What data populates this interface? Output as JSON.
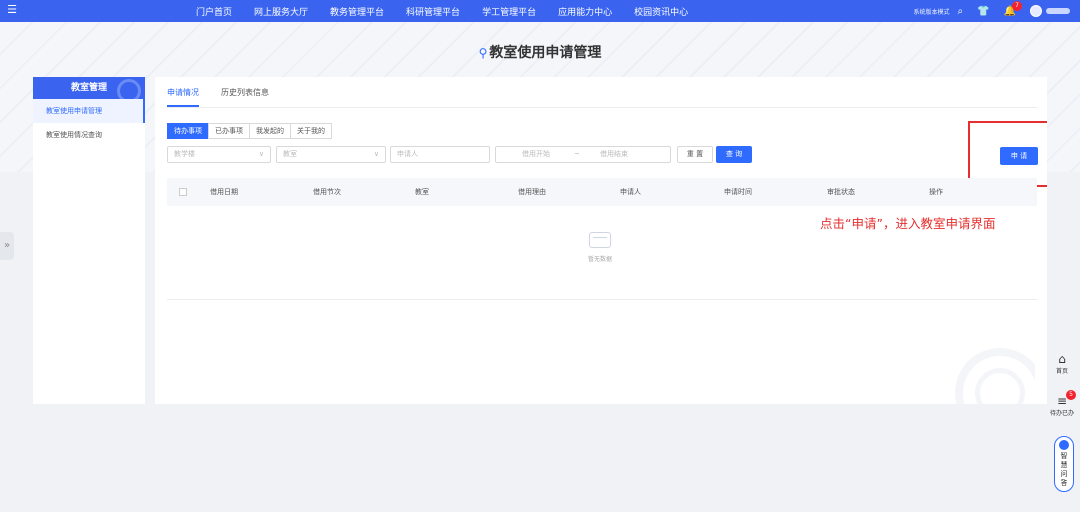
{
  "topbar": {
    "nav": [
      "门户首页",
      "网上服务大厅",
      "教务管理平台",
      "科研管理平台",
      "学工管理平台",
      "应用能力中心",
      "校园资讯中心"
    ],
    "switch_label": "系统版本模式",
    "bell_count": "7"
  },
  "page": {
    "title": "教室使用申请管理"
  },
  "sidebar": {
    "header": "教室管理",
    "items": [
      {
        "label": "教室使用申请管理"
      },
      {
        "label": "教室使用情况查询"
      }
    ]
  },
  "tabs": [
    "申请情况",
    "历史列表信息"
  ],
  "segments": [
    "待办事项",
    "已办事项",
    "我发起的",
    "关于我的"
  ],
  "filters": {
    "building_placeholder": "教学楼",
    "classroom_placeholder": "教室",
    "applicant_placeholder": "申请人",
    "start_placeholder": "借用开始",
    "range_separator": "~",
    "end_placeholder": "借用结束",
    "reset_label": "重 置",
    "query_label": "查 询"
  },
  "apply_label": "申 请",
  "table": {
    "headers": [
      "借用日期",
      "借用节次",
      "教室",
      "借用理由",
      "申请人",
      "申请时间",
      "审批状态",
      "操作"
    ],
    "empty_text": "暂无数据"
  },
  "annotation": "点击“申请”，进入教室申请界面",
  "floating": {
    "home": "首页",
    "todo": "待办已办",
    "todo_count": "5",
    "assistant": [
      "智",
      "慧",
      "问",
      "答"
    ]
  },
  "colors": {
    "primary": "#2f6bff",
    "topbar": "#3a64f0",
    "annotation_red": "#e62e2e"
  }
}
